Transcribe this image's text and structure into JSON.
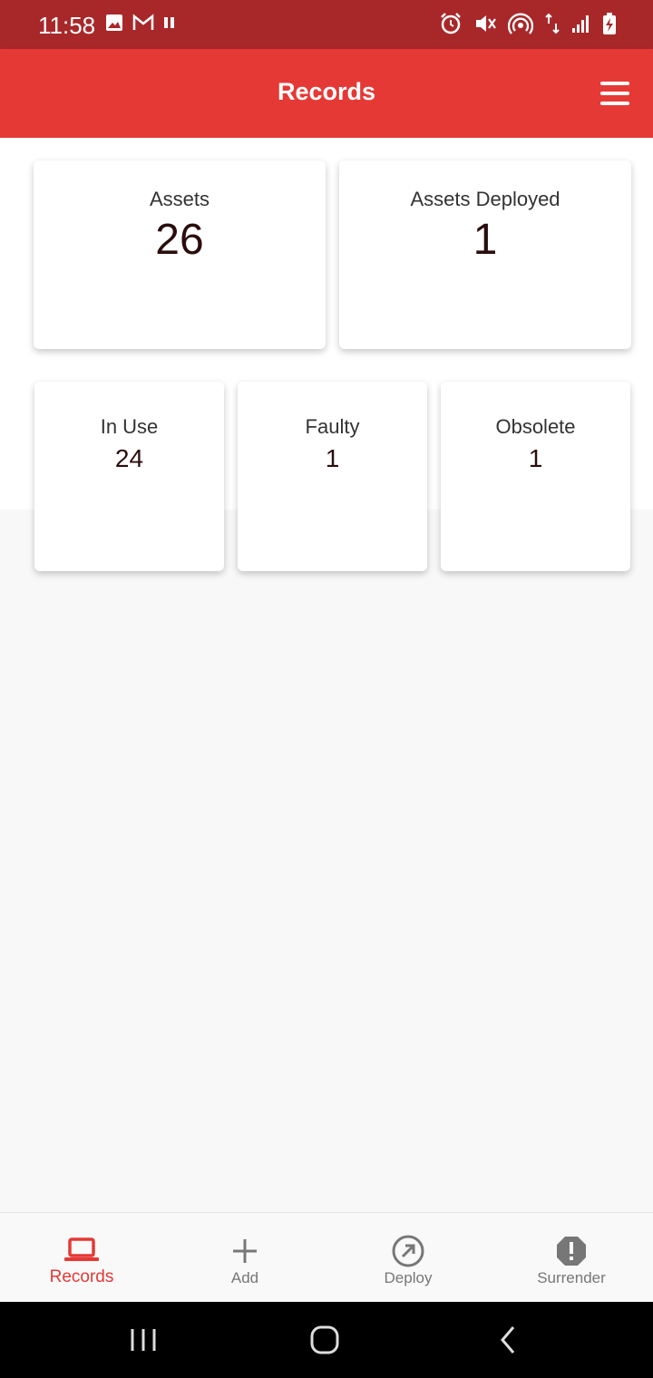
{
  "status_bar": {
    "time": "11:58",
    "left_icons": [
      "image-icon",
      "gmail-icon",
      "pause-icon"
    ],
    "right_icons": [
      "alarm-icon",
      "mute-icon",
      "hotspot-icon",
      "data-icon",
      "signal-icon",
      "battery-charging-icon"
    ]
  },
  "app_bar": {
    "title": "Records",
    "menu_icon": "hamburger-menu-icon"
  },
  "summary": {
    "assets": {
      "label": "Assets",
      "value": "26"
    },
    "assets_deployed": {
      "label": "Assets Deployed",
      "value": "1"
    }
  },
  "status_counts": {
    "in_use": {
      "label": "In Use",
      "value": "24"
    },
    "faulty": {
      "label": "Faulty",
      "value": "1"
    },
    "obsolete": {
      "label": "Obsolete",
      "value": "1"
    }
  },
  "bottom_nav": {
    "items": [
      {
        "label": "Records",
        "icon": "laptop-icon",
        "active": true
      },
      {
        "label": "Add",
        "icon": "plus-icon",
        "active": false
      },
      {
        "label": "Deploy",
        "icon": "arrow-up-right-circle-icon",
        "active": false
      },
      {
        "label": "Surrender",
        "icon": "alert-octagon-icon",
        "active": false
      }
    ]
  },
  "colors": {
    "status_bar": "#a8282a",
    "app_bar": "#e53935",
    "accent": "#e53935",
    "inactive": "#777777"
  }
}
